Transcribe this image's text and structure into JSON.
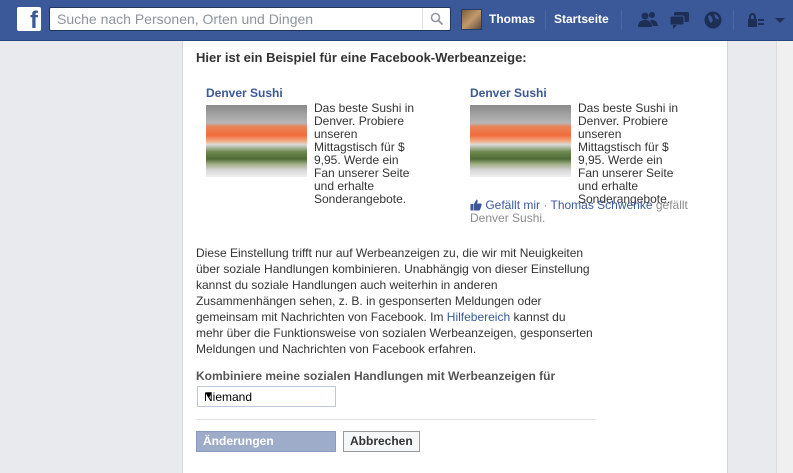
{
  "header": {
    "logo": "f",
    "search_placeholder": "Suche nach Personen, Orten und Dingen",
    "user_name": "Thomas",
    "home_label": "Startseite"
  },
  "page": {
    "example_title": "Hier ist ein Beispiel für eine Facebook-Werbeanzeige:",
    "ad_left": {
      "title": "Denver Sushi",
      "text": "Das beste Sushi in Denver. Probiere unseren Mittagstisch für $ 9,95. Werde ein Fan unserer Seite und erhalte Sonderangebote."
    },
    "ad_right": {
      "title": "Denver Sushi",
      "text": "Das beste Sushi in Denver. Probiere unseren Mittagstisch für $ 9,95. Werde ein Fan unserer Seite und erhalte Sonderangebote.",
      "like_label": "Gefällt mir",
      "separator": " · ",
      "friend_name": "Thomas Schwenke",
      "like_suffix": " gefällt",
      "page_name": "Denver Sushi."
    },
    "description_part1": "Diese Einstellung trifft nur auf Werbeanzeigen zu, die wir mit Neuigkeiten über soziale Handlungen kombinieren. Unabhängig von dieser Einstellung kannst du soziale Handlungen auch weiterhin in anderen Zusammenhängen sehen, z. B. in gesponserten Meldungen oder gemeinsam mit Nachrichten von Facebook. Im ",
    "help_link": "Hilfebereich",
    "description_part2": " kannst du mehr über die Funktionsweise von sozialen Werbeanzeigen, gesponserten Meldungen und Nachrichten von Facebook erfahren.",
    "combine_label": "Kombiniere meine sozialen Handlungen mit Werbeanzeigen für",
    "select_value": "Niemand",
    "save_button": "Änderungen speichern",
    "cancel_button": "Abbrechen"
  },
  "colors": {
    "brand_blue": "#3b5998",
    "save_disabled": "#9eacc9"
  }
}
